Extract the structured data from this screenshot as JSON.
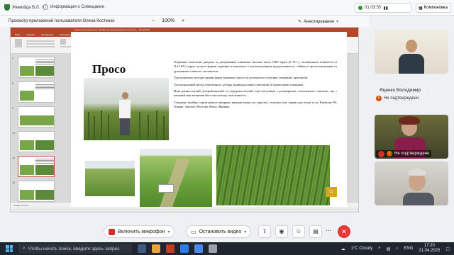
{
  "topbar": {
    "user": "Жемойда В.Л.",
    "info_label": "Информация о Совещании",
    "timer": "01:03:55",
    "layout_label": "Компоновка"
  },
  "viewer": {
    "title": "Просмотр приложений пользователя Олена Костенко",
    "zoom_minus": "−",
    "zoom_value": "100%",
    "zoom_plus": "+",
    "annotate_label": "Аннотирование"
  },
  "slide": {
    "title": "Просо",
    "paragraphs": [
      "Отримані генетичні джерела за донуванням ознаками: високої маси 1000 зерен (9-10 г), оптимальної плівчастості (14-16%) зерна, кулясті форми зернівки в комплексі з високим рівнем продуктивності, стійкості проти вилягання та ураженням сажкою і меланозом",
      "Удосконалено методи оцінки форм зернових проса за допомогою сучасних технічних пристроїв.",
      "Удосконалений метод генетичного добору індивідуальних генотипів за індексними ознаками.",
      "Нові раннестиглий детермінантний та середньостиглий сорт-популяція з розширеною генетичною основою, що є вагомий мак визначив його екологічну пластичність.",
      "Створено пінійку сортів різного напряму використання: на харчові і технічні цілі, корми для птиці та ін. Київське 96, Озірне, Заповіт, Веселка, Кеша, Жнивка"
    ],
    "page_number": "11"
  },
  "ppt": {
    "title_bar": "Презентація досягнень лабораторії селекції круп'яних культур — PowerPoint",
    "tabs": [
      "Файл",
      "Основне",
      "Вставлення",
      "Конструктор",
      "Переходи",
      "Анімація",
      "Показ слайдів",
      "Рецензування",
      "Вигляд",
      "Довідка"
    ],
    "thumb_numbers": [
      "7",
      "8",
      "9",
      "10",
      "11",
      "12"
    ],
    "status": "Слайд 11 из 32"
  },
  "participants": [
    {
      "name": "",
      "status": ""
    },
    {
      "name": "Яценко Володимир",
      "status": "Не подтверждено"
    },
    {
      "name": "",
      "status": "Не подтверждено"
    },
    {
      "name": "",
      "status": ""
    }
  ],
  "toolbar": {
    "mic_label": "Включить микрофон",
    "video_label": "Остановить видео"
  },
  "taskbar": {
    "search_placeholder": "Чтобы начать поиск, введите здесь запрос",
    "weather": "1°C  Cloudy",
    "lang": "ENG",
    "time": "17:20",
    "date": "21.04.2025"
  },
  "colors": {
    "ppt_accent": "#b7472a",
    "slide_number_bg": "#d6a71b",
    "end_call": "#e53935",
    "warning": "#d35400"
  }
}
